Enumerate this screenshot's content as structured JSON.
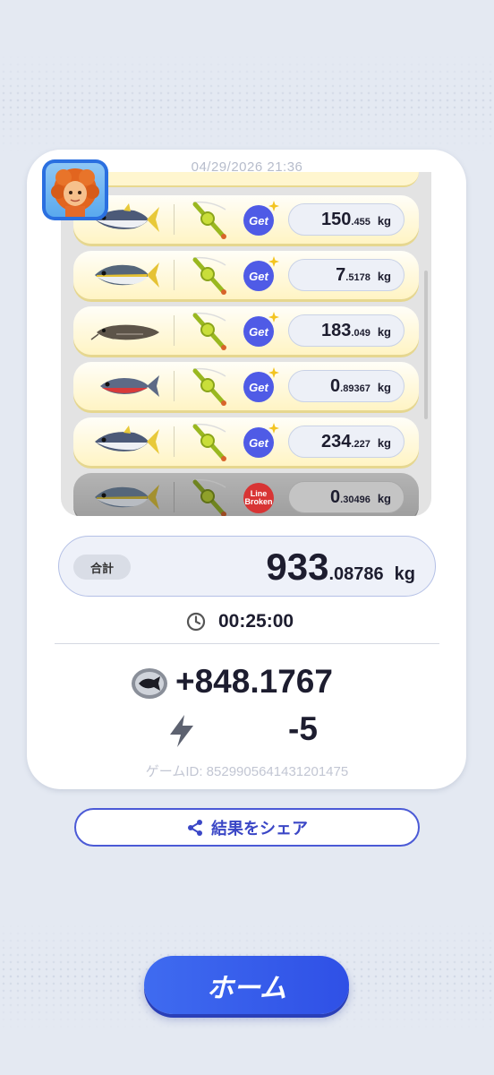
{
  "header": {
    "date": "04/29/2026 21:36"
  },
  "catches": [
    {
      "fish": "bluefin-tuna",
      "badge": "Get",
      "weight_int": "150",
      "weight_dec": ".455",
      "unit": "kg",
      "broken": false
    },
    {
      "fish": "yellowtail",
      "badge": "Get",
      "weight_int": "7",
      "weight_dec": ".5178",
      "unit": "kg",
      "broken": false
    },
    {
      "fish": "catfish",
      "badge": "Get",
      "weight_int": "183",
      "weight_dec": ".049",
      "unit": "kg",
      "broken": false
    },
    {
      "fish": "red-fish",
      "badge": "Get",
      "weight_int": "0",
      "weight_dec": ".89367",
      "unit": "kg",
      "broken": false
    },
    {
      "fish": "tuna",
      "badge": "Get",
      "weight_int": "234",
      "weight_dec": ".227",
      "unit": "kg",
      "broken": false
    },
    {
      "fish": "yellowtail",
      "badge_line1": "Line",
      "badge_line2": "Broken",
      "weight_int": "0",
      "weight_dec": ".30496",
      "unit": "kg",
      "broken": true
    }
  ],
  "total": {
    "label": "合計",
    "int": "933",
    "dec": ".08786",
    "unit": "kg"
  },
  "time": "00:25:00",
  "reward": {
    "coins": "+848.1767",
    "energy": "-5"
  },
  "game_id": "ゲームID: 8529905641431201475",
  "share_label": "結果をシェア",
  "home_label": "ホーム",
  "colors": {
    "accent": "#3f6bf0",
    "badge_get": "#4f5be6",
    "badge_broken": "#d83434"
  }
}
